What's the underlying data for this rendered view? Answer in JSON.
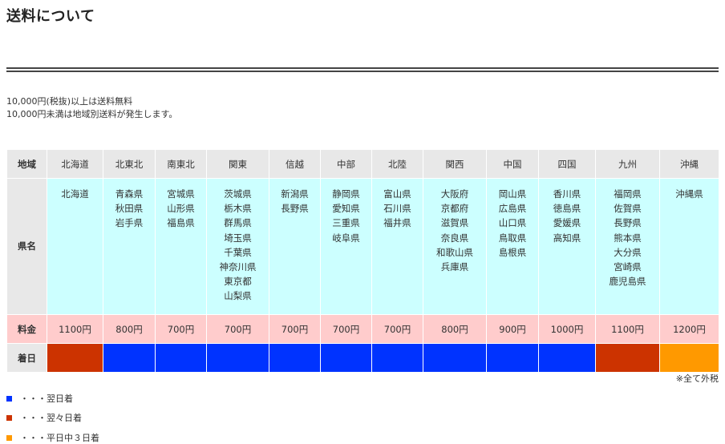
{
  "page_title": "送料について",
  "intro": {
    "line1": "10,000円(税抜)以上は送料無料",
    "line2": "10,000円未満は地域別送料が発生します。"
  },
  "table": {
    "row_labels": {
      "region": "地域",
      "prefectures": "県名",
      "price": "料金",
      "arrival": "着日"
    },
    "regions": [
      {
        "name": "北海道",
        "prefectures": [
          "北海道"
        ],
        "price": "1100円",
        "arrival": "翌々日着",
        "color": "#cc3300"
      },
      {
        "name": "北東北",
        "prefectures": [
          "青森県",
          "秋田県",
          "岩手県"
        ],
        "price": "800円",
        "arrival": "翌日着",
        "color": "#0033ff"
      },
      {
        "name": "南東北",
        "prefectures": [
          "宮城県",
          "山形県",
          "福島県"
        ],
        "price": "700円",
        "arrival": "翌日着",
        "color": "#0033ff"
      },
      {
        "name": "関東",
        "prefectures": [
          "茨城県",
          "栃木県",
          "群馬県",
          "埼玉県",
          "千葉県",
          "神奈川県",
          "東京都",
          "山梨県"
        ],
        "price": "700円",
        "arrival": "翌日着",
        "color": "#0033ff"
      },
      {
        "name": "信越",
        "prefectures": [
          "新潟県",
          "長野県"
        ],
        "price": "700円",
        "arrival": "翌日着",
        "color": "#0033ff"
      },
      {
        "name": "中部",
        "prefectures": [
          "静岡県",
          "愛知県",
          "三重県",
          "岐阜県"
        ],
        "price": "700円",
        "arrival": "翌日着",
        "color": "#0033ff"
      },
      {
        "name": "北陸",
        "prefectures": [
          "富山県",
          "石川県",
          "福井県"
        ],
        "price": "700円",
        "arrival": "翌日着",
        "color": "#0033ff"
      },
      {
        "name": "関西",
        "prefectures": [
          "大阪府",
          "京都府",
          "滋賀県",
          "奈良県",
          "和歌山県",
          "兵庫県"
        ],
        "price": "800円",
        "arrival": "翌日着",
        "color": "#0033ff"
      },
      {
        "name": "中国",
        "prefectures": [
          "岡山県",
          "広島県",
          "山口県",
          "鳥取県",
          "島根県"
        ],
        "price": "900円",
        "arrival": "翌日着",
        "color": "#0033ff"
      },
      {
        "name": "四国",
        "prefectures": [
          "香川県",
          "徳島県",
          "愛媛県",
          "高知県"
        ],
        "price": "1000円",
        "arrival": "翌日着",
        "color": "#0033ff"
      },
      {
        "name": "九州",
        "prefectures": [
          "福岡県",
          "佐賀県",
          "長野県",
          "熊本県",
          "大分県",
          "宮崎県",
          "鹿児島県"
        ],
        "price": "1100円",
        "arrival": "翌々日着",
        "color": "#cc3300"
      },
      {
        "name": "沖縄",
        "prefectures": [
          "沖縄県"
        ],
        "price": "1200円",
        "arrival": "平日中３日着",
        "color": "#ff9900"
      }
    ]
  },
  "tax_note": "※全て外税",
  "legend": [
    {
      "text": "・・・翌日着",
      "color": "#0033ff"
    },
    {
      "text": "・・・翌々日着",
      "color": "#cc3300"
    },
    {
      "text": "・・・平日中３日着",
      "color": "#ff9900"
    }
  ]
}
